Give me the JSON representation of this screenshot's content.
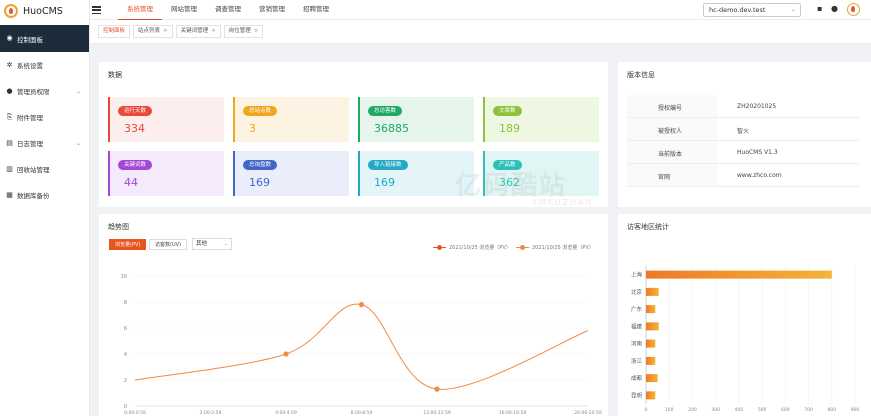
{
  "app": {
    "name": "HuoCMS"
  },
  "sidebar": {
    "items": [
      {
        "label": "控制面板",
        "icon": "dashboard-icon"
      },
      {
        "label": "系统设置",
        "icon": "gear-icon"
      },
      {
        "label": "管理员权限",
        "icon": "user-icon",
        "has_caret": true
      },
      {
        "label": "附件管理",
        "icon": "attachment-icon"
      },
      {
        "label": "日志管理",
        "icon": "log-icon",
        "has_caret": true
      },
      {
        "label": "回收站管理",
        "icon": "trash-icon"
      },
      {
        "label": "数据库备份",
        "icon": "database-icon"
      }
    ]
  },
  "topnav": {
    "items": [
      "系统管理",
      "网站管理",
      "调查管理",
      "营销管理",
      "招聘管理"
    ]
  },
  "site_select": {
    "value": "hc-demo.dev.test"
  },
  "tabs": [
    "控制面板",
    "站点列表",
    "关键词管理",
    "岗位管理"
  ],
  "stats": {
    "title": "数据",
    "cards": [
      {
        "label": "运行天数",
        "value": "334",
        "color": "#e8493b",
        "bg": "#fdeeee"
      },
      {
        "label": "总站点数",
        "value": "3",
        "color": "#f0a51e",
        "bg": "#fdf3e2"
      },
      {
        "label": "总访客数",
        "value": "36885",
        "color": "#21a865",
        "bg": "#e6f5ec"
      },
      {
        "label": "文章数",
        "value": "189",
        "color": "#8cc23c",
        "bg": "#eef7e2"
      },
      {
        "label": "关键词数",
        "value": "44",
        "color": "#a347d6",
        "bg": "#f4eafb"
      },
      {
        "label": "总询盘数",
        "value": "169",
        "color": "#4465c8",
        "bg": "#e9eefa"
      },
      {
        "label": "导入链接数",
        "value": "169",
        "color": "#24a8c5",
        "bg": "#e4f5f9"
      },
      {
        "label": "产品数",
        "value": "362",
        "color": "#2ec0b6",
        "bg": "#e0f6f4"
      }
    ]
  },
  "version": {
    "title": "版本信息",
    "rows": [
      {
        "key": "授权编号",
        "value": "ZH20201025"
      },
      {
        "key": "被授权人",
        "value": "智火"
      },
      {
        "key": "当前版本",
        "value": "HuoCMS V1.3"
      },
      {
        "key": "官网",
        "value": "www.zhco.com"
      }
    ]
  },
  "trend": {
    "title": "趋势图",
    "buttons": [
      "浏览量(PV)",
      "访客数(UV)"
    ],
    "select_value": "其他",
    "legend": [
      "2021/10/25 浏览量（PV）",
      "2021/10/25 浏览量（PV）"
    ]
  },
  "region": {
    "title": "访客地区统计"
  },
  "watermark": {
    "text": "亿码酷站",
    "sub": "YMKUZHAN"
  },
  "chart_data": [
    {
      "type": "line",
      "title": "",
      "x": [
        "0:00-0:59",
        "2:00-2:59",
        "4:00-4:59",
        "8:00-8:59",
        "12:00-12:59",
        "16:00-16:59",
        "20:00-20:59"
      ],
      "y_ticks": [
        0,
        2,
        4,
        6,
        8,
        10
      ],
      "ylim": [
        0,
        10
      ],
      "points": [
        {
          "x": "0:00-0:59",
          "y": 2
        },
        {
          "x": "4:00-4:59",
          "y": 4
        },
        {
          "x": "8:00-8:59",
          "y": 7.8
        },
        {
          "x": "12:00-12:59",
          "y": 1.3
        },
        {
          "x": "20:00-20:59",
          "y": 5.8
        }
      ],
      "series_color": "#f08a45"
    },
    {
      "type": "bar",
      "orientation": "horizontal",
      "categories": [
        "上海",
        "北京",
        "广东",
        "福建",
        "河南",
        "浙江",
        "成都",
        "昆明"
      ],
      "values": [
        800,
        55,
        40,
        55,
        40,
        40,
        50,
        40
      ],
      "x_ticks": [
        0,
        100,
        200,
        300,
        400,
        500,
        600,
        700,
        800,
        900
      ],
      "xlim": [
        0,
        900
      ],
      "color_start": "#ee7a24",
      "color_end": "#f5b33a"
    }
  ]
}
